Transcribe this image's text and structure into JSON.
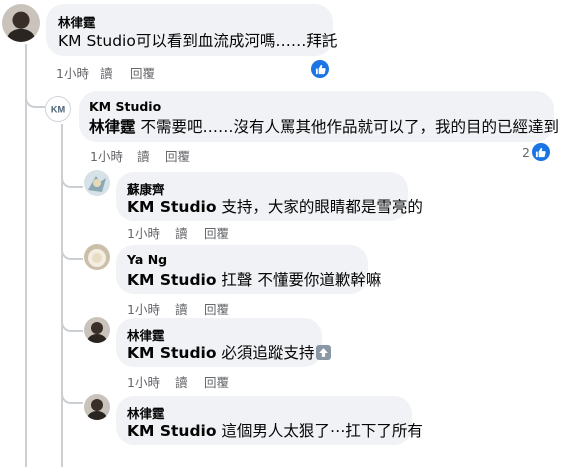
{
  "comments": [
    {
      "name": "林律霆",
      "text": "KM Studio可以看到血流成河嗎……拜託",
      "time": "1小時",
      "read": "讀",
      "reply": "回覆",
      "reaction_count": ""
    },
    {
      "name": "KM Studio",
      "tag": "林律霆",
      "text": " 不需要吧……沒有人罵其他作品就可以了，我的目的已經達到",
      "time": "1小時",
      "read": "讀",
      "reply": "回覆",
      "reaction_count": "2"
    },
    {
      "name": "蘇康齊",
      "tag": "KM Studio",
      "text": " 支持，大家的眼睛都是雪亮的",
      "time": "1小時",
      "read": "讀",
      "reply": "回覆"
    },
    {
      "name": "Ya Ng",
      "tag": "KM Studio",
      "text": " 扛聲 不懂要你道歉幹嘛",
      "time": "1小時",
      "read": "讀",
      "reply": "回覆"
    },
    {
      "name": "林律霆",
      "tag": "KM Studio",
      "text": " 必須追蹤支持",
      "time": "1小時",
      "read": "讀",
      "reply": "回覆"
    },
    {
      "name": "林律霆",
      "tag": "KM Studio",
      "text": " 這個男人太狠了⋯扛下了所有",
      "time": "",
      "read": "",
      "reply": ""
    }
  ],
  "icons": {
    "like": "like-icon",
    "up_arrow": "up-arrow-emoji"
  },
  "colors": {
    "bubble": "#f0f2f5",
    "meta": "#65676b",
    "like_blue": "#1b74e4",
    "thread_line": "#ccd0d5"
  }
}
